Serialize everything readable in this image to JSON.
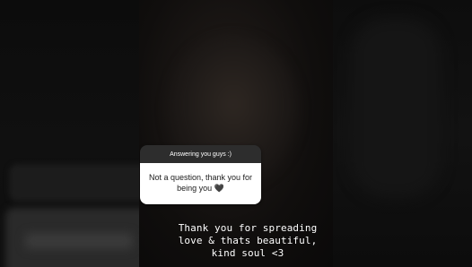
{
  "question_sticker": {
    "header": "Answering you guys :)",
    "question": "Not a question, thank you for being you 🖤"
  },
  "caption": {
    "text": "Thank you for spreading\nlove & thats beautiful,\nkind soul <3"
  }
}
